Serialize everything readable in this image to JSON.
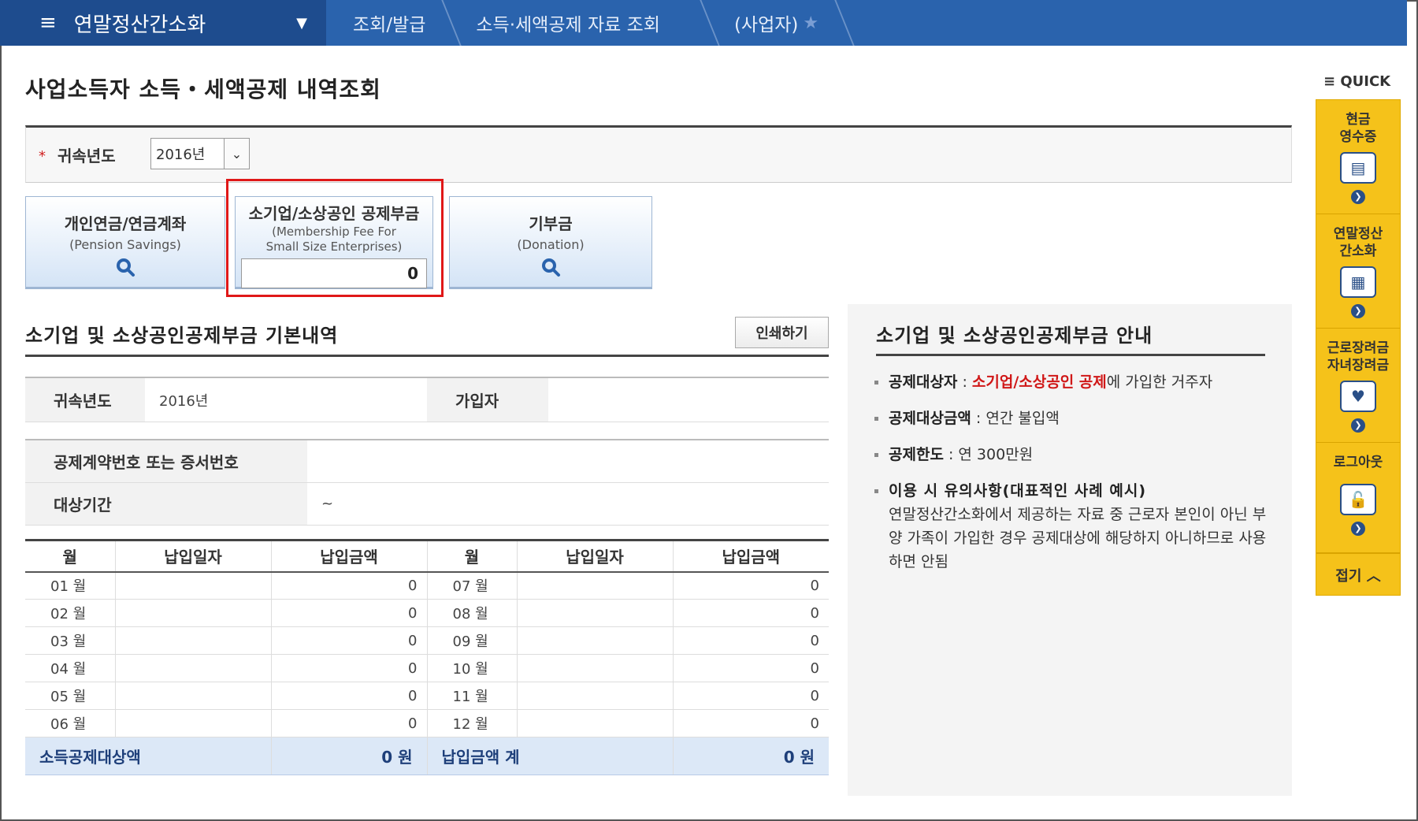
{
  "nav": {
    "home": "연말정산간소화",
    "crumbs": [
      "조회/발급",
      "소득·세액공제 자료 조회",
      "(사업자)"
    ]
  },
  "page_title": "사업소득자 소득・세액공제 내역조회",
  "search": {
    "year_label": "귀속년도",
    "year_value": "2016년"
  },
  "tabs": {
    "pension": {
      "title": "개인연금/연금계좌",
      "subtitle": "(Pension Savings)"
    },
    "small": {
      "title": "소기업/소상공인 공제부금",
      "subtitle1": "(Membership Fee For",
      "subtitle2": "Small Size Enterprises)",
      "amount": "0"
    },
    "donation": {
      "title": "기부금",
      "subtitle": "(Donation)"
    }
  },
  "basic": {
    "title": "소기업 및 소상공인공제부금 기본내역",
    "print_label": "인쇄하기",
    "year_label": "귀속년도",
    "year_value": "2016년",
    "subscriber_label": "가입자",
    "subscriber_value": "",
    "contract_label": "공제계약번호 또는 증서번호",
    "contract_value": "",
    "period_label": "대상기간",
    "period_value": "~"
  },
  "monthly": {
    "headers": [
      "월",
      "납입일자",
      "납입금액",
      "월",
      "납입일자",
      "납입금액"
    ],
    "rows": [
      {
        "m1": "01 월",
        "d1": "",
        "a1": "0",
        "m2": "07 월",
        "d2": "",
        "a2": "0"
      },
      {
        "m1": "02 월",
        "d1": "",
        "a1": "0",
        "m2": "08 월",
        "d2": "",
        "a2": "0"
      },
      {
        "m1": "03 월",
        "d1": "",
        "a1": "0",
        "m2": "09 월",
        "d2": "",
        "a2": "0"
      },
      {
        "m1": "04 월",
        "d1": "",
        "a1": "0",
        "m2": "10 월",
        "d2": "",
        "a2": "0"
      },
      {
        "m1": "05 월",
        "d1": "",
        "a1": "0",
        "m2": "11 월",
        "d2": "",
        "a2": "0"
      },
      {
        "m1": "06 월",
        "d1": "",
        "a1": "0",
        "m2": "12 월",
        "d2": "",
        "a2": "0"
      }
    ],
    "total": {
      "label1": "소득공제대상액",
      "value1": "0 원",
      "label2": "납입금액 계",
      "value2": "0 원"
    }
  },
  "guide": {
    "title": "소기업 및 소상공인공제부금 안내",
    "target_label": "공제대상자",
    "target_red": "소기업/소상공인 공제",
    "target_rest": "에 가입한 거주자",
    "amount_label": "공제대상금액",
    "amount_text": "연간 불입액",
    "limit_label": "공제한도",
    "limit_text": "연 300만원",
    "note_title": "이용 시 유의사항(대표적인 사례 예시)",
    "note_text": "연말정산간소화에서 제공하는 자료 중 근로자 본인이 아닌 부양 가족이 가입한 경우 공제대상에 해당하지 아니하므로 사용하면 안됨"
  },
  "quick": {
    "header": "QUICK",
    "items": [
      {
        "label1": "현금",
        "label2": "영수증",
        "icon": "receipt-icon"
      },
      {
        "label1": "연말정산",
        "label2": "간소화",
        "icon": "calculator-icon"
      },
      {
        "label1": "근로장려금",
        "label2": "자녀장려금",
        "icon": "heart-icon"
      },
      {
        "label1": "로그아웃",
        "label2": "",
        "icon": "lock-icon"
      }
    ],
    "fold": "접기"
  },
  "colors": {
    "nav": "#2a63ad",
    "nav_home": "#1e4c8e",
    "quick": "#f5c21a",
    "highlight": "#e01818",
    "accent_red": "#d01818"
  }
}
